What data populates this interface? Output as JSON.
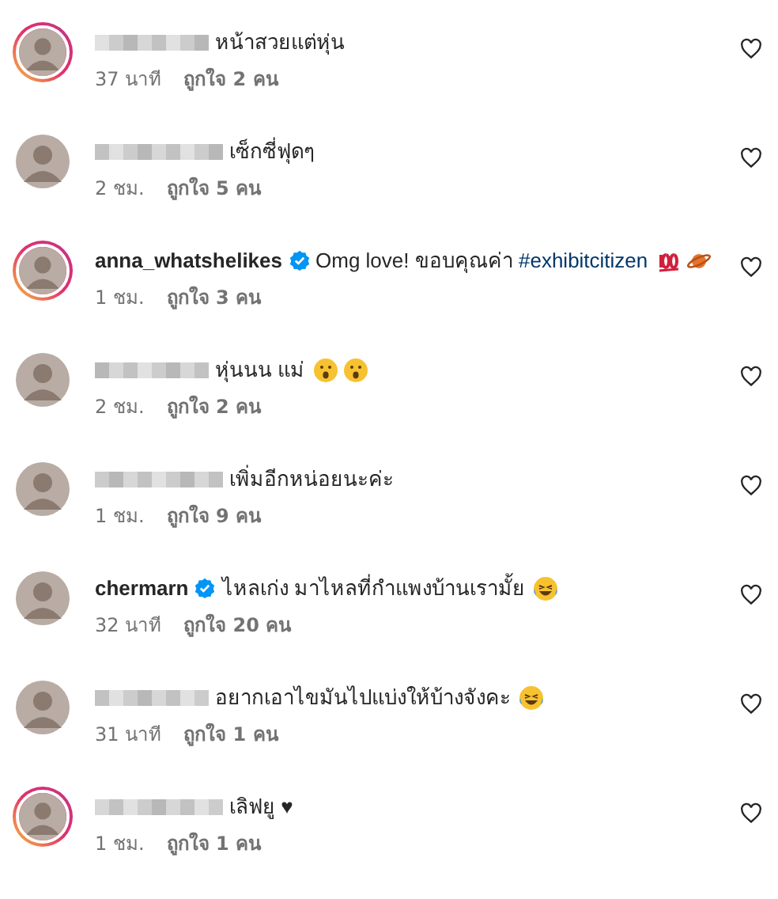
{
  "comments": [
    {
      "username_hidden": true,
      "story_ring": true,
      "verified": false,
      "text": "หน้าสวยแต่หุ่น",
      "time": "37 นาที",
      "likes": "ถูกใจ 2 คน"
    },
    {
      "username_hidden": true,
      "story_ring": false,
      "verified": false,
      "text": "เซ็กซี่ฟุดๆ",
      "time": "2 ชม.",
      "likes": "ถูกใจ 5 คน"
    },
    {
      "username": "anna_whatshelikes",
      "story_ring": true,
      "verified": true,
      "text": "Omg love! ขอบคุณค่า",
      "hashtag": "#exhibitcitizen",
      "time": "1 ชม.",
      "likes": "ถูกใจ 3 คน",
      "emojis": [
        {
          "kind": "hundred"
        },
        {
          "kind": "planet"
        }
      ]
    },
    {
      "username_hidden": true,
      "story_ring": false,
      "verified": false,
      "text": "หุ่นนน แม่",
      "time": "2 ชม.",
      "likes": "ถูกใจ 2 คน",
      "emojis": [
        {
          "kind": "surprised"
        },
        {
          "kind": "surprised"
        }
      ]
    },
    {
      "username_hidden": true,
      "story_ring": false,
      "verified": false,
      "text": "เพิ่มอีกหน่อยนะค่ะ",
      "time": "1 ชม.",
      "likes": "ถูกใจ 9 คน"
    },
    {
      "username": "chermarn",
      "story_ring": false,
      "verified": true,
      "text": "ไหลเก่ง มาไหลที่กำแพงบ้านเรามั้ย",
      "time": "32 นาที",
      "likes": "ถูกใจ 20 คน",
      "emojis": [
        {
          "kind": "laughing"
        }
      ]
    },
    {
      "username_hidden": true,
      "story_ring": false,
      "verified": false,
      "text": "อยากเอาไขมันไปแบ่งให้บ้างจังคะ",
      "time": "31 นาที",
      "likes": "ถูกใจ 1 คน",
      "emojis": [
        {
          "kind": "laughing"
        }
      ]
    },
    {
      "username_hidden": true,
      "story_ring": true,
      "verified": false,
      "text": "เลิฟยู ♥",
      "time": "1 ชม.",
      "likes": "ถูกใจ 1 คน"
    }
  ]
}
